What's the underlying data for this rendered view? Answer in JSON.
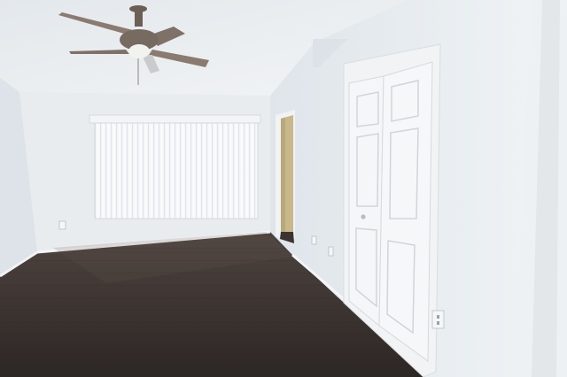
{
  "scene": {
    "description_free": true,
    "colors": {
      "ceiling": "#eef1f3",
      "wall_back": "#eaeef1",
      "wall_left": "#dfe5ea",
      "wall_right": "#e4e9ed",
      "floor_dark": "#2f2a28",
      "floor_mid": "#4a403b",
      "blinds": "#f7f9fb",
      "door": "#f4f5f6",
      "trim": "#f3f4f5",
      "hallway": "#c9b98a",
      "fan_metal": "#6b5f56",
      "fan_blade": "#8a7a70"
    }
  }
}
